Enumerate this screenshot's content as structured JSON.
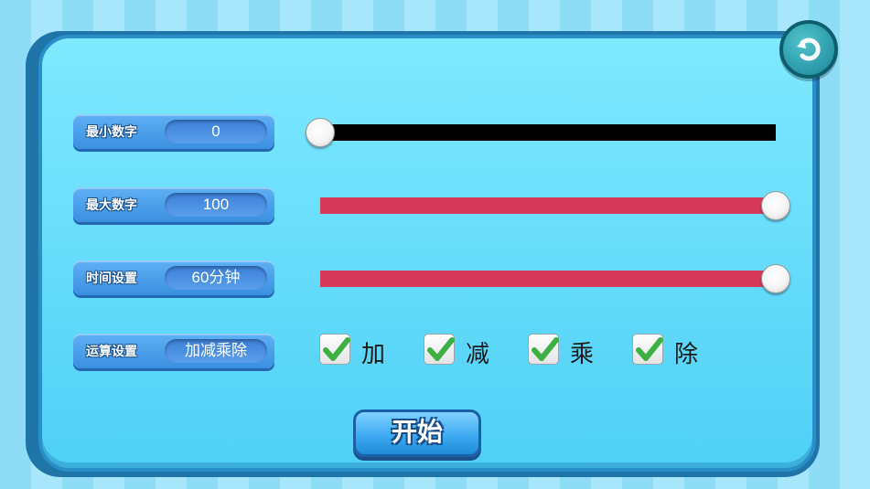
{
  "settings": {
    "min_number": {
      "label": "最小数字",
      "value": "0",
      "slider_fraction": 0.0,
      "track_color": "#000000"
    },
    "max_number": {
      "label": "最大数字",
      "value": "100",
      "slider_fraction": 1.0,
      "track_color": "#d7395a"
    },
    "time": {
      "label": "时间设置",
      "value": "60分钟",
      "slider_fraction": 1.0,
      "track_color": "#d7395a"
    },
    "operations": {
      "label": "运算设置",
      "value": "加减乘除",
      "options": [
        {
          "label": "加",
          "checked": true
        },
        {
          "label": "减",
          "checked": true
        },
        {
          "label": "乘",
          "checked": true
        },
        {
          "label": "除",
          "checked": true
        }
      ]
    }
  },
  "buttons": {
    "start": "开始",
    "back_icon": "undo-arrow-icon"
  },
  "colors": {
    "panel": "#5fdaf8",
    "checkmark": "#3cb043",
    "accent_blue": "#3a8fe0"
  }
}
